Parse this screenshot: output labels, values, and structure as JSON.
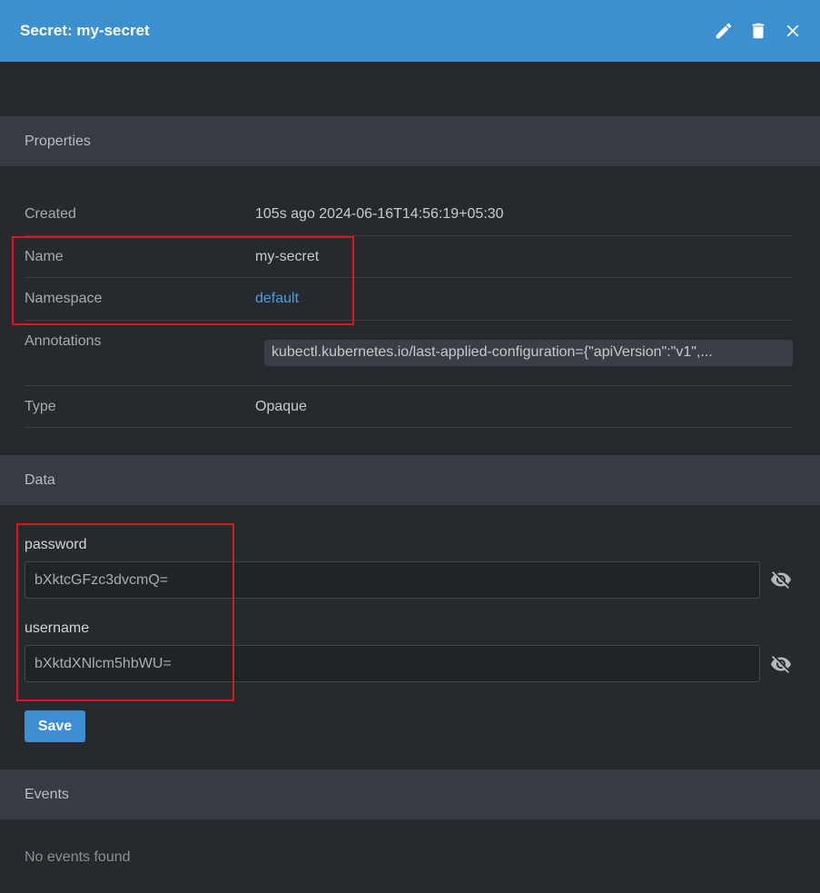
{
  "header": {
    "title": "Secret: my-secret",
    "actions": [
      {
        "name": "edit",
        "icon": "pencil-icon"
      },
      {
        "name": "delete",
        "icon": "trash-icon"
      },
      {
        "name": "close",
        "icon": "close-icon"
      }
    ]
  },
  "sections": {
    "properties": "Properties",
    "data": "Data",
    "events": "Events"
  },
  "properties": {
    "created": {
      "label": "Created",
      "value": "105s ago 2024-06-16T14:56:19+05:30"
    },
    "name": {
      "label": "Name",
      "value": "my-secret"
    },
    "namespace": {
      "label": "Namespace",
      "value": "default"
    },
    "annotations": {
      "label": "Annotations",
      "value": "kubectl.kubernetes.io/last-applied-configuration={\"apiVersion\":\"v1\",..."
    },
    "type": {
      "label": "Type",
      "value": "Opaque"
    }
  },
  "data": {
    "items": [
      {
        "key": "password",
        "value": "bXktcGFzc3dvcmQ="
      },
      {
        "key": "username",
        "value": "bXktdXNlcm5hbWU="
      }
    ],
    "save_label": "Save"
  },
  "events": {
    "empty_text": "No events found"
  },
  "colors": {
    "header": "#3d90d0",
    "background": "#262a2f",
    "section": "#383c42",
    "link": "#4a9ee0",
    "highlight": "#e0141c"
  }
}
